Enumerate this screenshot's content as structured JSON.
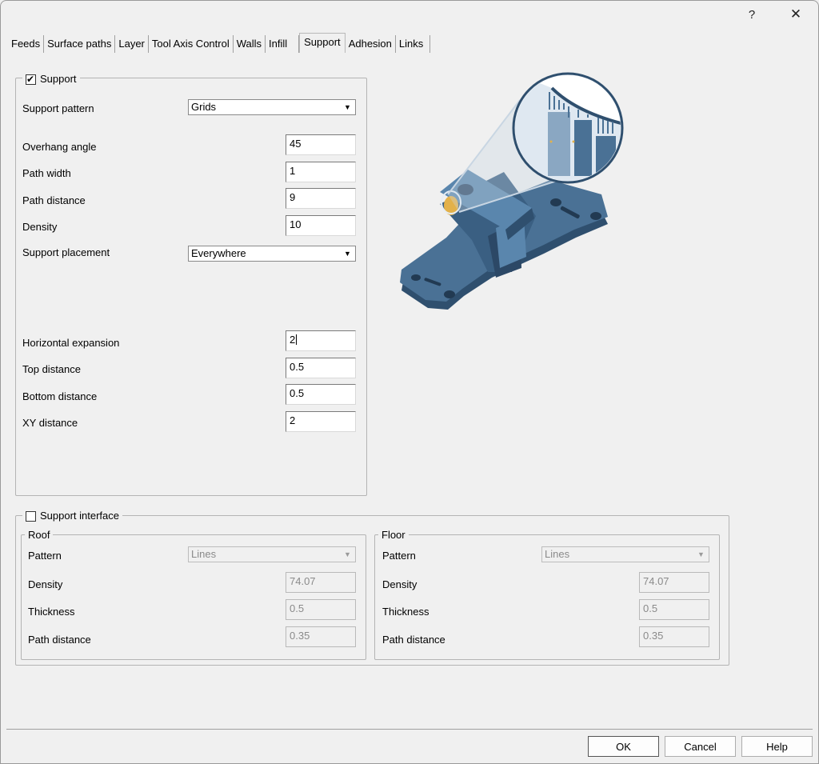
{
  "titlebar": {
    "help": "?",
    "close": "✕"
  },
  "tabs": [
    {
      "label": "Feeds"
    },
    {
      "label": "Surface paths"
    },
    {
      "label": "Layer"
    },
    {
      "label": "Tool Axis Control"
    },
    {
      "label": "Walls"
    },
    {
      "label": "Infill"
    },
    {
      "label": "Support"
    },
    {
      "label": "Adhesion"
    },
    {
      "label": "Links"
    }
  ],
  "support": {
    "title": "Support",
    "checked": true,
    "pattern_label": "Support pattern",
    "pattern_value": "Grids",
    "overhang_label": "Overhang angle",
    "overhang_value": "45",
    "path_width_label": "Path width",
    "path_width_value": "1",
    "path_distance_label": "Path distance",
    "path_distance_value": "9",
    "density_label": "Density",
    "density_value": "10",
    "placement_label": "Support placement",
    "placement_value": "Everywhere",
    "h_expansion_label": "Horizontal expansion",
    "h_expansion_value": "2",
    "top_distance_label": "Top distance",
    "top_distance_value": "0.5",
    "bottom_distance_label": "Bottom distance",
    "bottom_distance_value": "0.5",
    "xy_distance_label": "XY distance",
    "xy_distance_value": "2"
  },
  "interface": {
    "title": "Support interface",
    "checked": false,
    "roof": {
      "title": "Roof",
      "pattern_label": "Pattern",
      "pattern_value": "Lines",
      "density_label": "Density",
      "density_value": "74.07",
      "thickness_label": "Thickness",
      "thickness_value": "0.5",
      "path_distance_label": "Path distance",
      "path_distance_value": "0.35"
    },
    "floor": {
      "title": "Floor",
      "pattern_label": "Pattern",
      "pattern_value": "Lines",
      "density_label": "Density",
      "density_value": "74.07",
      "thickness_label": "Thickness",
      "thickness_value": "0.5",
      "path_distance_label": "Path distance",
      "path_distance_value": "0.35"
    }
  },
  "buttons": {
    "ok": "OK",
    "cancel": "Cancel",
    "help": "Help"
  },
  "colors": {
    "part": "#4a7195",
    "part_dark": "#2f4f6e",
    "accent": "#e3b14a"
  },
  "icons": {
    "dropdown": "▼",
    "check": "✔"
  }
}
